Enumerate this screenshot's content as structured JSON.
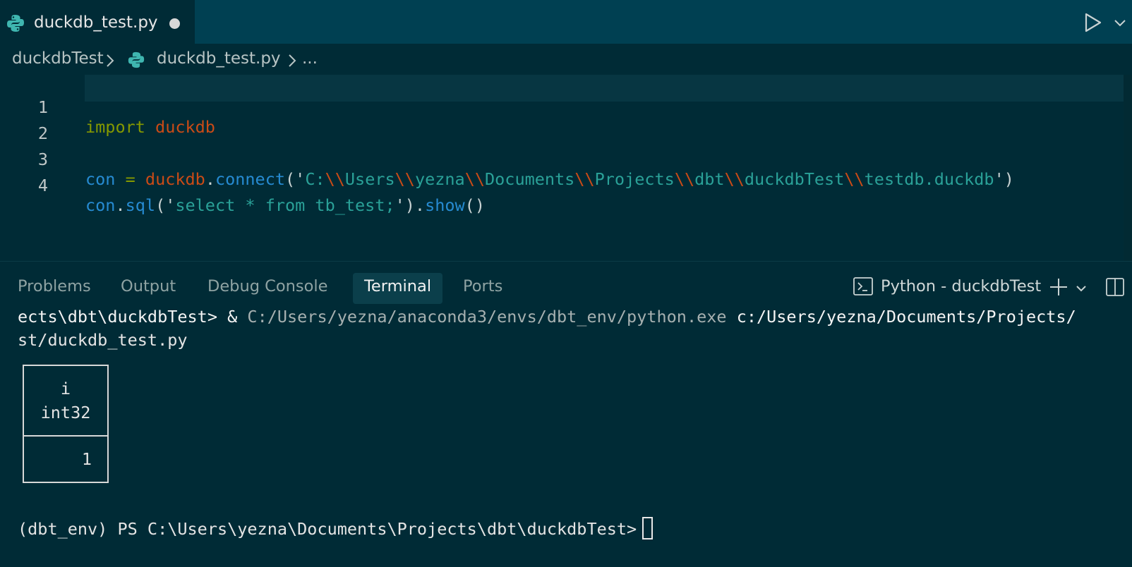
{
  "tab": {
    "filename": "duckdb_test.py"
  },
  "breadcrumb": {
    "folder": "duckdbTest",
    "file": "duckdb_test.py",
    "more": "..."
  },
  "editor": {
    "line_numbers": [
      "1",
      "2",
      "3",
      "4"
    ],
    "line1": {
      "kw": "import",
      "mod": "duckdb"
    },
    "line3": {
      "var": "con",
      "op": "=",
      "mod": "duckdb",
      "dot": ".",
      "fn": "connect",
      "open": "('",
      "parts": [
        "C:",
        "\\\\",
        "Users",
        "\\\\",
        "yezna",
        "\\\\",
        "Documents",
        "\\\\",
        "Projects",
        "\\\\",
        "dbt",
        "\\\\",
        "duckdbTest",
        "\\\\",
        "testdb.duckdb"
      ],
      "close": "')"
    },
    "line4": {
      "var": "con",
      "dot1": ".",
      "fn1": "sql",
      "open": "('",
      "str": "select * from tb_test;",
      "close": "')",
      "dot2": ".",
      "fn2": "show",
      "parens": "()"
    }
  },
  "panel": {
    "tabs": [
      "Problems",
      "Output",
      "Debug Console",
      "Terminal",
      "Ports"
    ],
    "active_tab": "Terminal",
    "terminal_name": "Python - duckdbTest"
  },
  "terminal": {
    "cmd_prefix": "ects\\dbt\\duckdbTest> & ",
    "cmd_python": "C:/Users/yezna/anaconda3/envs/dbt_env/python.exe",
    "cmd_script": " c:/Users/yezna/Documents/Projects/",
    "cmd_cont": "st/duckdb_test.py",
    "result": {
      "col_name": "i",
      "col_type": "int32",
      "value": "1"
    },
    "prompt": "(dbt_env) PS C:\\Users\\yezna\\Documents\\Projects\\dbt\\duckdbTest>"
  },
  "colors": {
    "bg": "#002b36",
    "keyword": "#859900",
    "module": "#cb4b16",
    "function": "#268bd2",
    "string": "#2aa198"
  },
  "icons": [
    "python-file-icon",
    "run-icon",
    "chevron-down-icon",
    "chevron-right-icon",
    "terminal-icon",
    "plus-icon",
    "split-panel-icon"
  ]
}
